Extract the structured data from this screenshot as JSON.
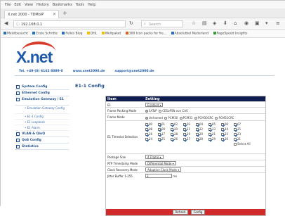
{
  "browser": {
    "menu": [
      "File",
      "Edit",
      "View",
      "History",
      "Bookmarks",
      "Tools",
      "Help"
    ],
    "tab_title": "X.net 2000 - TDMoIP",
    "url": "192.168.0.1",
    "search_placeholder": "Search",
    "bookmarks": [
      "Meistbesucht",
      "Erste Schritte",
      "Felles Blog",
      "DHL",
      "Weltpaket",
      "300 Icon packs for fre...",
      "Absolutbel Nederland",
      "PageSpeed Insights"
    ]
  },
  "site": {
    "logo_text": "X.net",
    "tel": "Tel. +49-(0) 6162 8089-0",
    "web": "www.xnet2000.de",
    "email": "support@xnet2000.de"
  },
  "sidebar": {
    "items": [
      {
        "label": "System Config"
      },
      {
        "label": "Ethernet Config"
      },
      {
        "label": "Emulation Gateway / E1"
      },
      {
        "label": "VLAN & QinQ"
      },
      {
        "label": "QoS Config"
      },
      {
        "label": "Statistics"
      }
    ],
    "sub": [
      "Emulation Gateway Config",
      "E1-1 Config",
      "E1 Loopback",
      "E1 Alarm"
    ]
  },
  "page_title": "E1-1 Config",
  "table": {
    "col_item": "Item",
    "col_setting": "Setting",
    "rows": {
      "e1": {
        "label": "E1",
        "value": "Enabled"
      },
      "packing": {
        "label": "Frame Packing Mode",
        "opt1": "SAToP",
        "opt2": "CESoPSN non CAS"
      },
      "framemode": {
        "label": "Frame Mode",
        "opts": [
          "Unframed",
          "PCM30",
          "PCM31",
          "PCM30CRC",
          "PCM31CRC"
        ]
      },
      "timeslot": {
        "label": "E1 Timeslot Selection",
        "slots": [
          "00",
          "01",
          "02",
          "03",
          "04",
          "05",
          "06",
          "07",
          "08",
          "09",
          "10",
          "11",
          "12",
          "13",
          "14",
          "15",
          "16",
          "17",
          "18",
          "19",
          "20",
          "21",
          "22",
          "23",
          "24",
          "25",
          "26",
          "27",
          "28",
          "29",
          "30",
          "31"
        ],
        "select_all": "Select All"
      },
      "package": {
        "label": "Package Size",
        "value": "4 Frame"
      },
      "rtp": {
        "label": "RTP Timestamp Mode",
        "value": "Differential Mode"
      },
      "clock": {
        "label": "Clock Recovery Mode",
        "value": "Adaptive Clock Mode"
      },
      "jitter": {
        "label": "Jitter Buffer 1-255",
        "value": "3",
        "unit": "ms"
      }
    },
    "buttons": {
      "refresh": "Refresh",
      "config": "Config"
    }
  },
  "colors": {
    "brand": "#1e5aa8",
    "header": "#0f1d4e",
    "footer": "#d02a2a"
  }
}
